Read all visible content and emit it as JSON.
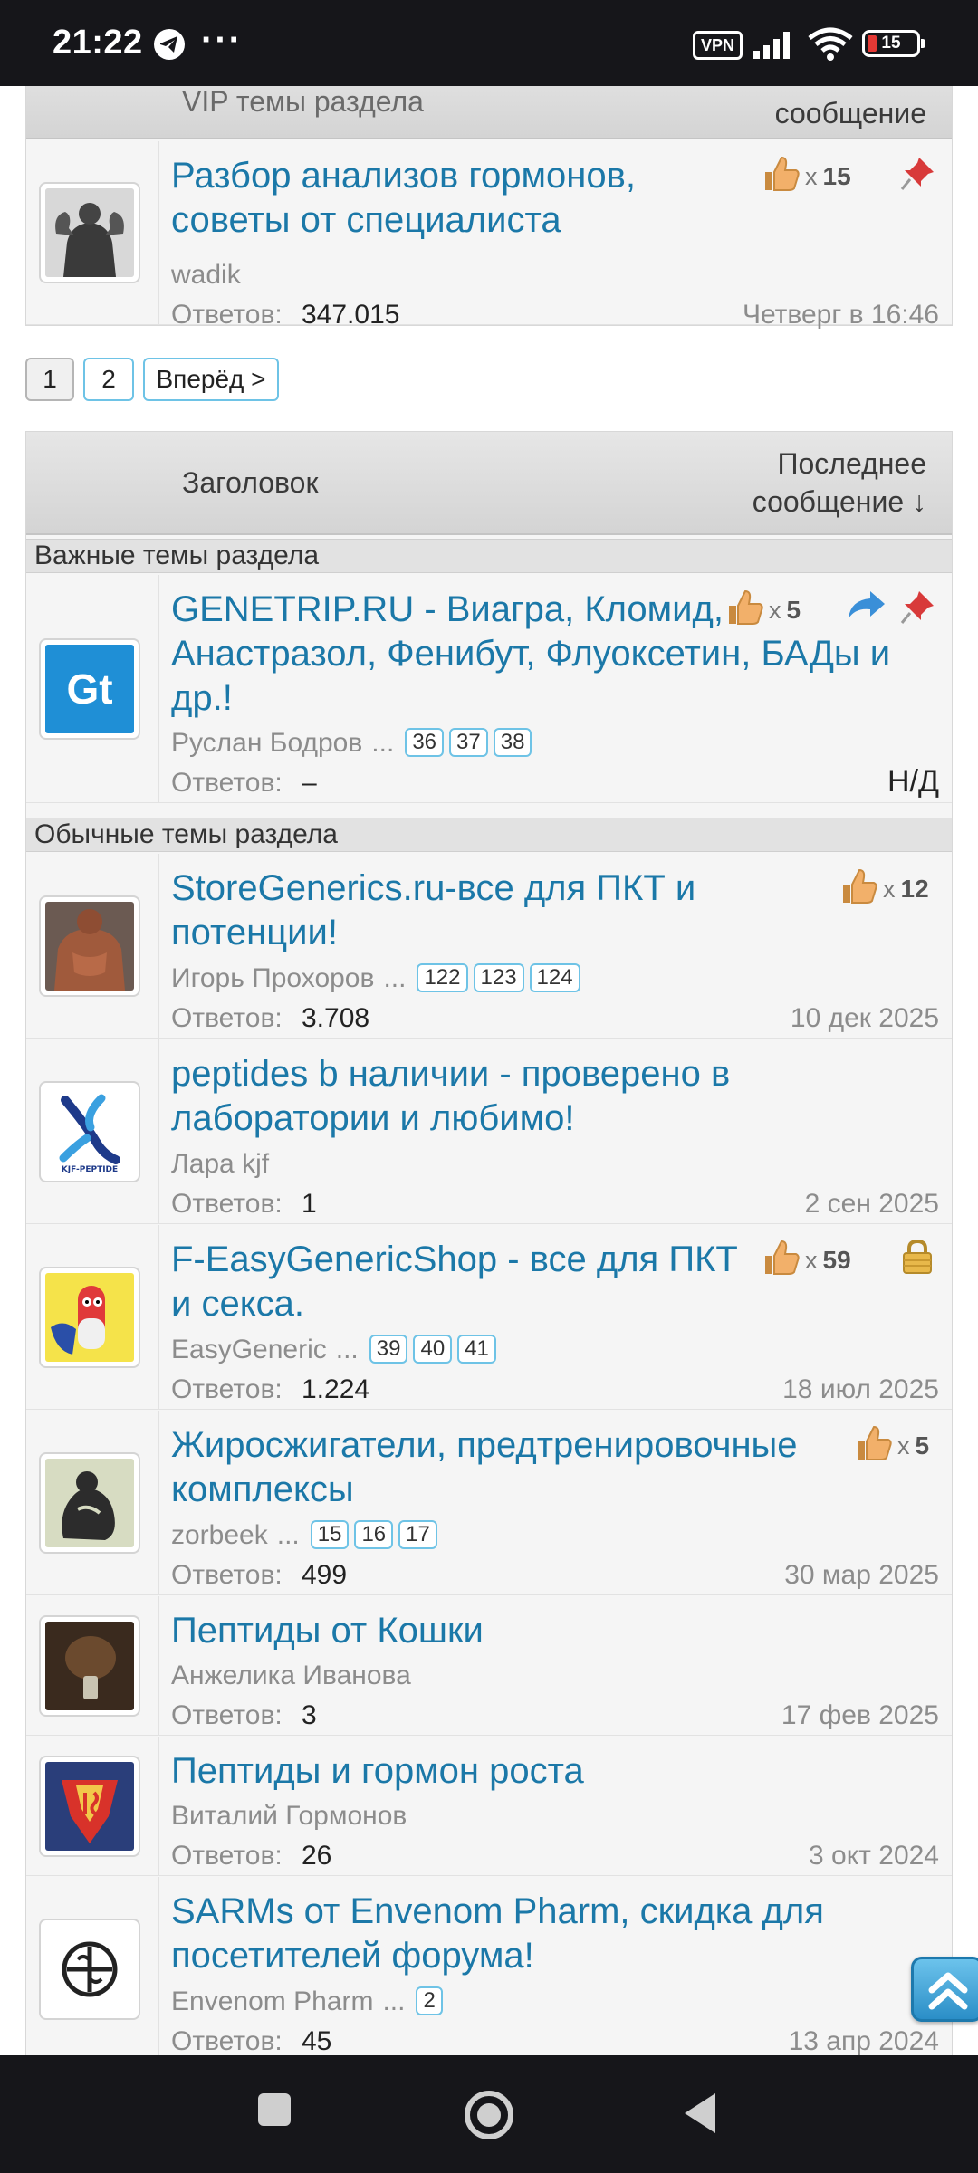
{
  "status_bar": {
    "time": "21:22",
    "vpn": "VPN",
    "battery": "15"
  },
  "vip_block": {
    "header_title": "VIP темы раздела",
    "header_last": "сообщение",
    "thread": {
      "title_line1": "Разбор анализов гормонов,",
      "title_line2": "советы от специалиста",
      "author": "wadik",
      "likes_x": "x",
      "likes": "15",
      "replies_label": "Ответов:",
      "replies": "347.015",
      "last_post": "Четверг в 16:46"
    }
  },
  "pagination": {
    "pages": [
      "1",
      "2"
    ],
    "next": "Вперёд >"
  },
  "main_block": {
    "header_title": "Заголовок",
    "header_last_line1": "Последнее",
    "header_last_line2": "сообщение ↓",
    "group_important": "Важные темы раздела",
    "group_regular": "Обычные темы раздела",
    "threads": [
      {
        "title_line1": "GENETRIP.RU - Виагра, Кломид,",
        "title_line2": "Анастразол, Фенибут, Флуоксетин, БАДы и",
        "title_line3": "др.!",
        "author": "Руслан Бодров",
        "ellipsis": "...",
        "pages": [
          "36",
          "37",
          "38"
        ],
        "likes_x": "x",
        "likes": "5",
        "replies_label": "Ответов:",
        "replies": "–",
        "last_post": "Н/Д"
      },
      {
        "title_line1": "StoreGenerics.ru-все для ПКТ и",
        "title_line2": "потенции!",
        "author": "Игорь Прохоров",
        "ellipsis": "...",
        "pages": [
          "122",
          "123",
          "124"
        ],
        "likes_x": "x",
        "likes": "12",
        "replies_label": "Ответов:",
        "replies": "3.708",
        "last_post": "10 дек 2025"
      },
      {
        "title_line1": "peptides b наличии - проверено в",
        "title_line2": "лаборатории и любимо!",
        "author": "Лара kjf",
        "avatar_caption": "KJF-PEPTIDE",
        "replies_label": "Ответов:",
        "replies": "1",
        "last_post": "2 сен 2025"
      },
      {
        "title_line1": "F-EasyGenericShop - все для ПКТ",
        "title_line2": "и секса.",
        "author": "EasyGeneric",
        "ellipsis": "...",
        "pages": [
          "39",
          "40",
          "41"
        ],
        "likes_x": "x",
        "likes": "59",
        "replies_label": "Ответов:",
        "replies": "1.224",
        "last_post": "18 июл 2025"
      },
      {
        "title_line1": "Жиросжигатели, предтренировочные",
        "title_line2": "комплексы",
        "author": "zorbeek",
        "ellipsis": "...",
        "pages": [
          "15",
          "16",
          "17"
        ],
        "likes_x": "x",
        "likes": "5",
        "replies_label": "Ответов:",
        "replies": "499",
        "last_post": "30 мар 2025"
      },
      {
        "title_line1": "Пептиды от Кошки",
        "author": "Анжелика Иванова",
        "replies_label": "Ответов:",
        "replies": "3",
        "last_post": "17 фев 2025"
      },
      {
        "title_line1": "Пептиды и гормон роста",
        "author": "Виталий Гормонов",
        "replies_label": "Ответов:",
        "replies": "26",
        "last_post": "3 окт 2024"
      },
      {
        "title_line1": "SARMs от Envenom Pharm, скидка для",
        "title_line2": "посетителей форума!",
        "author": "Envenom Pharm",
        "ellipsis": "...",
        "pages": [
          "2"
        ],
        "replies_label": "Ответов:",
        "replies": "45",
        "last_post": "13 апр 2024"
      }
    ]
  },
  "colors": {
    "link": "#1b78a8",
    "page_border": "#6ec3e6",
    "header_bg": "#d9d9d9"
  }
}
